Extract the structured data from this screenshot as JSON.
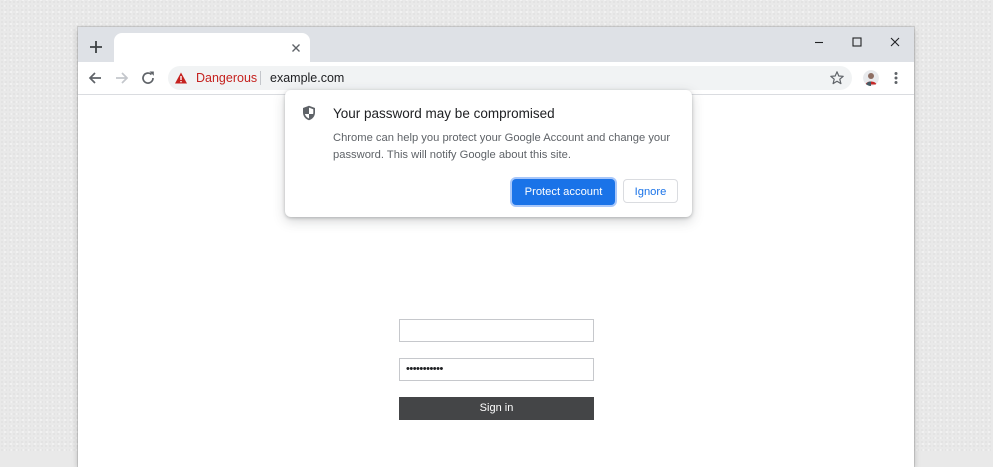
{
  "colors": {
    "accent": "#1a73e8",
    "danger": "#c5221f",
    "tab_strip": "#dee1e6",
    "omnibox": "#f1f3f4",
    "sign_in_button": "#444547",
    "backdrop": "#e9e9e9"
  },
  "tabstrip": {
    "new_tab_icon": "plus-icon",
    "tab_title": "",
    "tab_close_icon": "close-icon",
    "window_controls": [
      "minimize-icon",
      "maximize-icon",
      "close-icon"
    ]
  },
  "toolbar": {
    "back_icon": "arrow-left-icon",
    "forward_icon": "arrow-right-icon",
    "reload_icon": "reload-icon",
    "security_icon": "warning-triangle-icon",
    "security_label": "Dangerous",
    "url": "example.com",
    "bookmark_icon": "star-icon",
    "profile_icon": "avatar",
    "menu_icon": "more-vert-icon"
  },
  "bubble": {
    "icon": "shield-icon",
    "title": "Your password may be compromised",
    "body": "Chrome can help you protect your Google Account and change your password. This will notify Google about this site.",
    "primary_button": "Protect account",
    "secondary_button": "Ignore"
  },
  "page": {
    "username_value": "",
    "password_value": "•••••••••••",
    "sign_in_label": "Sign in"
  }
}
